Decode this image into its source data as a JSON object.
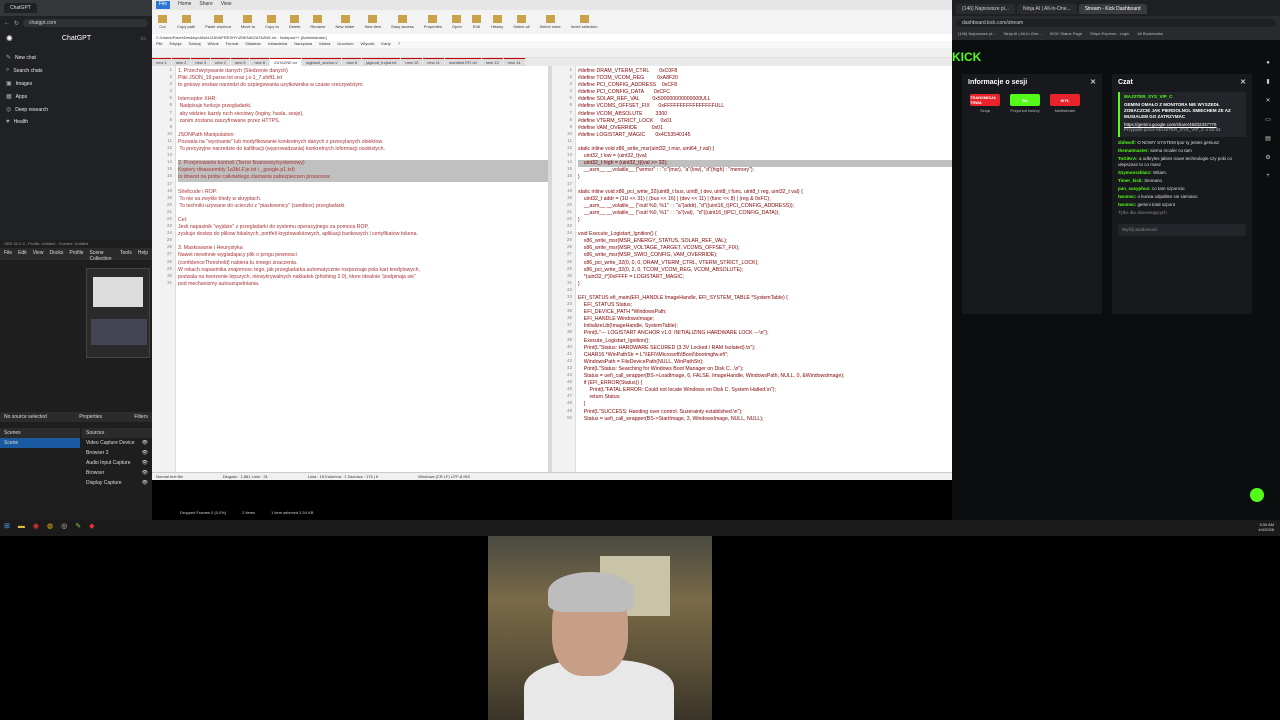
{
  "browser_left": {
    "tab_title": "ChatGPT",
    "url": "chatgpt.com",
    "app_name": "ChatGPT",
    "items": [
      "New chat",
      "Search chats",
      "Images",
      "Apps",
      "Deep research",
      "Health"
    ]
  },
  "obs": {
    "title": "OBS 32.0.4 - Profile: Untitled - Scenes: Untitled",
    "menu": [
      "File",
      "Edit",
      "View",
      "Docks",
      "Profile",
      "Scene Collection",
      "Tools",
      "Help"
    ],
    "no_source": "No source selected",
    "properties": "Properties",
    "filters": "Filters",
    "scenes_label": "Scenes",
    "sources_label": "Sources",
    "scene_name": "Scene",
    "sources": [
      "Video Capture Device",
      "Browser 2",
      "Audio Input Capture",
      "Browser",
      "Display Capture"
    ],
    "status": "Dropped Frames 0 (0.0%)"
  },
  "explorer": {
    "tabs": [
      "File",
      "Home",
      "Share",
      "View"
    ],
    "active_tab": "File",
    "ribbon": [
      "Cut",
      "Copy path",
      "Paste shortcut",
      "Move to",
      "Copy to",
      "Delete",
      "Rename",
      "New folder",
      "New item",
      "Easy access",
      "Properties",
      "Open",
      "Edit",
      "History",
      "Select all",
      "Select none",
      "Invert selection"
    ]
  },
  "npp": {
    "title": "C:\\Users\\Pavel\\Desktop\\ANALIZA\\INFRESHY\\ZNENA\\ZATAZNE.txt - Notepad++ [Administrator]",
    "menu": [
      "Plik",
      "Edycja",
      "Szukaj",
      "Widok",
      "Format",
      "Składnia",
      "Ustawienia",
      "Narzędzia",
      "Makra",
      "Uruchom",
      "Wtyczki",
      "Karty",
      "?"
    ],
    "tabs": [
      "new 1",
      "new 2",
      "new 3",
      "new 4",
      "new 5",
      "new 6",
      "ZATAZNE.txt",
      "logistart_anchor.c",
      "new 8",
      "jaglund_trojka.txt",
      "new 10",
      "new 11",
      "manifest EFI.txt",
      "new 13",
      "new 14"
    ],
    "active_tab": "ZATAZNE.txt",
    "left_lines": [
      "1. Przechwytywanie danych (Sledzenie danych)",
      "Pliki JSON_19.parse.txt oraz j.s-1_7.shift1.txt",
      "to gotowy zestaw narzedzi do szpiegowania uzytkownika w czasie rzeczywistym:",
      "",
      "Interceptor XHR:",
      " Nadpisuje funkcje przegladarki,",
      " aby widziec kazdy ruch sieciowy (loginy, hasla, sesje),",
      " zanim zostana zaszyfrowane przez HTTPS.",
      "",
      "JSONPath Manipulation:",
      "Pozwala na \"wycinanie\" lub modyfikowanie konkretnych danych z przesylanych obiektow.",
      " To precyzyjne narzedzie do kafiltracji (wyprowadzania) konkretnych informacji osobistych.",
      "",
      "2. Przejmowanie kontroli (Terror finansowy/systemowy)",
      "Kopiery dixassembly 1a3bLF.je.txt i _google.p1.txt)",
      "to dowod na probe calkowitego zlamania zabezpieczen procesora:",
      "",
      "Shellcode i ROP:",
      " To nie sa zwykle bledy w skryptach.",
      " To techniki uzywane do ucieczki z \"piaskownicy\" (sandbox) przegladarki.",
      "",
      "Cel:",
      "Jesli napastnik \"wyjdzie\" z przegladarki do systemu operacyjnego za pomoca ROP,",
      "zyskuje dostep do plikow lokalnych, portfeli kryptowalutowych, aplikacji bankowych i certyfikatow tokena.",
      "",
      "3. Maskowanie i Heurystyka",
      "Nawet niewinnie wygladajacy plik o progu pewnosci",
      "(confidenceThreshold) nabiera tu innego znaczenia.",
      "W rekach napastnika znajomosc tego, jak przegladarka automatycznie rozpoznaje pola kart kredytowych,",
      "pozwala na tworzenie lepszych, niewykrywalnych nakladek (phishing 2.0), ktore idealnie \"podpinaja sie\"",
      "pod mechanizmy autouzupelniania."
    ],
    "right_lines": [
      "#define DRAM_VTERM_CTRL       0xC0F8",
      "#define TCOM_VCOM_REG         0xA8F20",
      "#define PCI_CONFIG_ADDRESS    0xCF8",
      "#define PCI_CONFIG_DATA       0xCFC",
      "#define SOLAR_REF_VAL         0x500000000000000ULL",
      "#define VCOMS_OFFSET_FIX      0xFFFFFFFFFFFFFFFFULL",
      "#define VCOM_ABSOLUTE         3300",
      "#define VTERM_STRICT_LOCK     0x01",
      "#define VAM_OVERRIDE          0x01",
      "#define LOGISTART_MAGIC       0x4C53540145",
      "",
      "static inline void x86_write_msr(uint32_t msr, uint64_t val) {",
      "    uint32_t low = (uint32_t)val;",
      "    uint32_t high = (uint32_t)(val >> 32);",
      "    __asm__ __volatile__ (\"wrmsr\" : : \"c\"(msr), \"a\"(low), \"d\"(high) : \"memory\");",
      "}",
      "",
      "static inline void x86_pci_write_32(uint8_t bus, uint8_t dev, uint8_t func, uint8_t reg, uint32_t val) {",
      "    uint32_t addr = (1U << 31) | (bus << 16) | (dev << 11) | (func << 8) | (reg & 0xFC);",
      "    __asm__ __volatile__ (\"outl %0, %1\" : : \"a\"(addr), \"d\"((uint16_t)PCI_CONFIG_ADDRESS));",
      "    __asm__ __volatile__ (\"outl %0, %1\" : : \"a\"(val),  \"d\"((uint16_t)PCI_CONFIG_DATA));",
      "}",
      "",
      "void Execute_Logistart_Ignition() {",
      "    x86_write_msr(MSR_ENERGY_STATUS, SOLAR_REF_VAL);",
      "    x86_write_msr(MSR_VOLTAGE_TARGET, VCOMS_OFFSET_FIX);",
      "    x86_write_msr(MSR_SWIO_CONFIG, VAM_OVERRIDE);",
      "    x86_pci_write_32(0, 0, 0, DRAM_VTERM_CTRL, VTERM_STRICT_LOCK);",
      "    x86_pci_write_32(0, 2, 0, TCOM_VCOM_REG, VCOM_ABSOLUTE);",
      "    *(uint32_t*)0xFFFF = LOGISTART_MAGIC;",
      "}",
      "",
      "EFI_STATUS efi_main(EFI_HANDLE ImageHandle, EFI_SYSTEM_TABLE *SystemTable) {",
      "    EFI_STATUS Status;",
      "    EFI_DEVICE_PATH *WindowsPath;",
      "    EFI_HANDLE WindowsImage;",
      "    InitializeLib(ImageHandle, SystemTable);",
      "    Print(L\"--- LOGISTART ANCHOR v1.0: INITIALIZING HARDWARE LOCK ---\\n\");",
      "    Execute_Logistart_Ignition();",
      "    Print(L\"Status: HARDWARE SECURED (3.3V Locked / RAM Isolated).\\n\");",
      "    CHAR16 *WinPathStr = L\"\\\\EFI\\\\Microsoft\\\\Boot\\\\bootmgfw.efi\";",
      "    WindowsPath = FileDevicePath(NULL, WinPathStr);",
      "    Print(L\"Status: Searching for Windows Boot Manager on Disk C...\\n\");",
      "    Status = uefi_call_wrapper(BS->LoadImage, 6, FALSE, ImageHandle, WindowsPath, NULL, 0, &WindowsImage);",
      "    if (EFI_ERROR(Status)) {",
      "        Print(L\"FATAL ERROR: Could not locate Windows on Disk C. System Halted.\\n\");",
      "        return Status;",
      "    }",
      "    Print(L\"SUCCESS: Handing over control. Suzerainty established.\\n\");",
      "    Status = uefi_call_wrapper(BS->StartImage, 3, WindowsImage, NULL, NULL);"
    ],
    "right_start": 1,
    "status_left": "Normal text file",
    "status_mid": "Długość : 1,881    Linie : 31",
    "status_pos": "Linia : 15    Kolumna : 1    Zaznacz : 176 | 6",
    "status_enc": "Windows (CR LF)    UTF-8    INS"
  },
  "kick": {
    "tabs": [
      "(146) Najnowsze pl...",
      "Ninja AI | All-In-One...",
      "Stream - Kick Dashboard"
    ],
    "active_tab": "Stream - Kick Dashboard",
    "url": "dashboard.kick.com/stream",
    "bookmarks": [
      "(146) Najnowsze pl...",
      "Ninja AI | All-In-One...",
      "KICK Status Page",
      "Stripe Express - Login",
      "All Bookmarks"
    ],
    "logo": "KICK",
    "session_title": "Informacje o sesji",
    "session_buttons": [
      {
        "label": "TRANSMISJA TRWA",
        "sub": "Sesja",
        "color": "#e8232b"
      },
      {
        "label": "WŁ",
        "sub": "Przychód twórcy",
        "color": "#53fc18"
      },
      {
        "label": "WYŁ",
        "sub": "Multistream",
        "color": "#e8232b"
      }
    ],
    "chat_title": "Czat",
    "pinned_user": "MAJSTER_SYS_VIP_C",
    "pinned_text": "GEMINI OMAŁO Z MONITORA NIE WYSZEDŁ ZOBACZCIE JAK PIERDOLNOL SMIECHEM ZE AZ MUSIALEM GO ZATRZYMAC",
    "pinned_link": "https://gemini.google.com/share/48d32337776",
    "pinned_by": "Przypięte przez MAJSTER_SYS_VIP_C o 02:34",
    "messages": [
      {
        "user": "zbilwolf:",
        "text": "O NOWY SYSTEM tpor ty jestes geniusz"
      },
      {
        "user": "thematmaster:",
        "text": "siema mcaler co tam"
      },
      {
        "user": "ToGiKrA:",
        "text": "a odkryles jakies nowe technologie czy poki co ulepszasz to co masz"
      },
      {
        "user": "Szymonszklarz:",
        "text": "Witam."
      },
      {
        "user": "Timer_kick:",
        "text": "Siemano"
      },
      {
        "user": "pan_sasyphus:",
        "text": "co tam szponcio"
      },
      {
        "user": "twomsc:",
        "text": "o kurwa odpaliles sie siemano"
      },
      {
        "user": "twomsc:",
        "text": "gemini total szpont"
      }
    ],
    "chat_footer": "Tylko dla obserwujących",
    "chat_placeholder": "Wyślij wiadomość"
  },
  "taskbar": {
    "time": "3:30 AM",
    "date": "4/4/2026"
  },
  "obs_footer": {
    "dropped": "Dropped Frames 0 (0.0%)",
    "items": "2 items",
    "selected": "1 item selected  2.54 KB"
  }
}
